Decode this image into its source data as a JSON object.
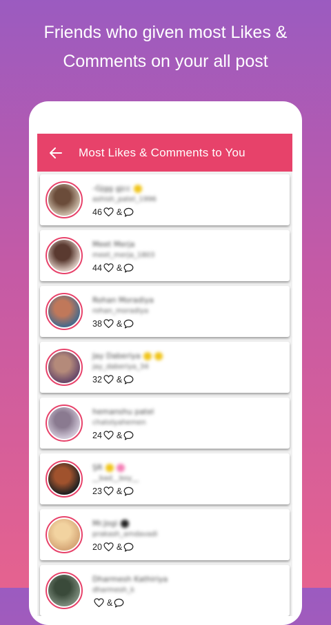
{
  "promo": {
    "line1": "Friends who given most Likes &",
    "line2": "Comments on your all post"
  },
  "appbar": {
    "back_icon": "arrow-left-icon",
    "title": "Most Likes & Comments to You"
  },
  "colors": {
    "accent": "#e7426a",
    "bg_top": "#9b5bc0",
    "bg_bottom": "#e5628f"
  },
  "users": [
    {
      "name": "-Gjgg gjcc",
      "username": "ashish_patel_1996",
      "count": "46",
      "emojis": [
        "#f0c419"
      ],
      "avatar": [
        "#c9b8a5",
        "#6b4c3a"
      ]
    },
    {
      "name": "Meet Merja",
      "username": "meet_merja_1803",
      "count": "44",
      "emojis": [],
      "avatar": [
        "#d8c6bd",
        "#5a3a30"
      ]
    },
    {
      "name": "Rohan Moradiya",
      "username": "rohan_moradiya",
      "count": "38",
      "emojis": [],
      "avatar": [
        "#4a6a8a",
        "#c0785a"
      ]
    },
    {
      "name": "Jay Daberiya",
      "username": "jay_daberiya_34",
      "count": "32",
      "emojis": [
        "#f0c419",
        "#f0c419"
      ],
      "avatar": [
        "#6a4a6a",
        "#b48a7a"
      ]
    },
    {
      "name": "hemanshu patel",
      "username": "chatolyahemen",
      "count": "24",
      "emojis": [],
      "avatar": [
        "#cfc6d6",
        "#8a7a90"
      ]
    },
    {
      "name": "ŞR",
      "username": "__bad__boy__",
      "count": "23",
      "emojis": [
        "#f0c419",
        "#f47fb5"
      ],
      "avatar": [
        "#222222",
        "#a0522d"
      ]
    },
    {
      "name": "Mr.Jogi",
      "username": "prakash_amdavadi",
      "count": "20",
      "emojis": [
        "#222222"
      ],
      "avatar": [
        "#d6a878",
        "#f2d3a0"
      ]
    },
    {
      "name": "Dharmesh Kathiriya",
      "username": "dharmesh_k",
      "count": "",
      "emojis": [],
      "avatar": [
        "#7a8a7a",
        "#3a4a3a"
      ]
    }
  ]
}
